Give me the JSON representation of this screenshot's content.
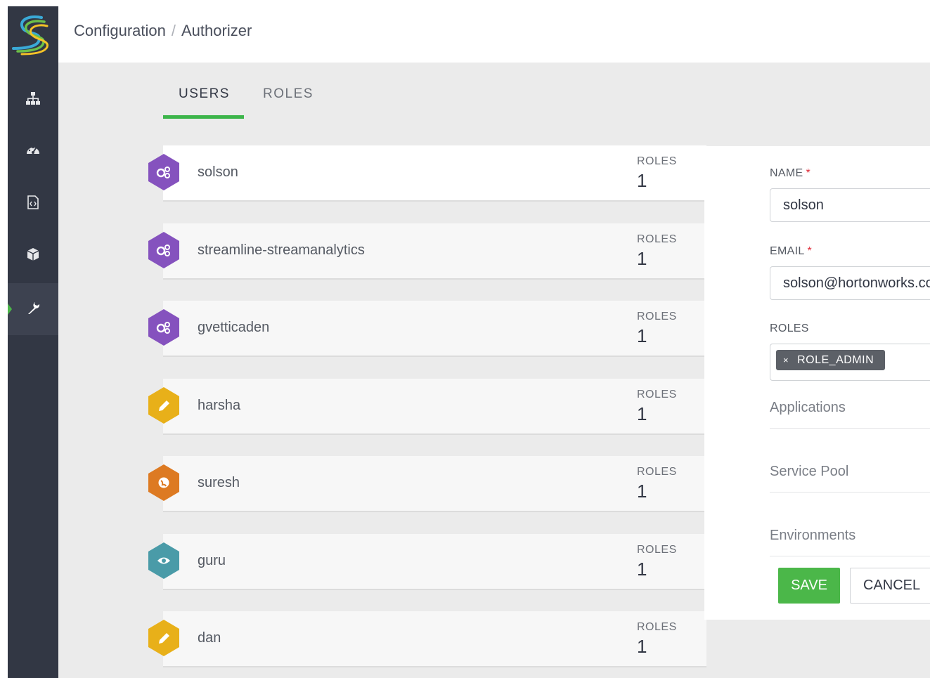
{
  "breadcrumb": {
    "parent": "Configuration",
    "separator": "/",
    "current": "Authorizer"
  },
  "sidebar": {
    "logo": "streamline-logo",
    "items": [
      {
        "name": "topology",
        "icon": "sitemap-icon",
        "active": false
      },
      {
        "name": "dashboard",
        "icon": "dashboard-icon",
        "active": false
      },
      {
        "name": "code",
        "icon": "file-code-icon",
        "active": false
      },
      {
        "name": "packages",
        "icon": "cube-icon",
        "active": false
      },
      {
        "name": "configuration",
        "icon": "wrench-icon",
        "active": true
      }
    ]
  },
  "tabs": [
    {
      "label": "USERS",
      "active": true
    },
    {
      "label": "ROLES",
      "active": false
    }
  ],
  "users": [
    {
      "name": "solson",
      "roles_label": "ROLES",
      "roles_count": "1",
      "icon": "cogs-icon",
      "color": "#8552be"
    },
    {
      "name": "streamline-streamanalytics",
      "roles_label": "ROLES",
      "roles_count": "1",
      "icon": "cogs-icon",
      "color": "#8552be"
    },
    {
      "name": "gvetticaden",
      "roles_label": "ROLES",
      "roles_count": "1",
      "icon": "cogs-icon",
      "color": "#8552be"
    },
    {
      "name": "harsha",
      "roles_label": "ROLES",
      "roles_count": "1",
      "icon": "pencil-icon",
      "color": "#e8b019"
    },
    {
      "name": "suresh",
      "roles_label": "ROLES",
      "roles_count": "1",
      "icon": "globe-icon",
      "color": "#dd7a22"
    },
    {
      "name": "guru",
      "roles_label": "ROLES",
      "roles_count": "1",
      "icon": "eye-icon",
      "color": "#4a9ba8"
    },
    {
      "name": "dan",
      "roles_label": "ROLES",
      "roles_count": "1",
      "icon": "pencil-icon",
      "color": "#e8b019"
    }
  ],
  "form": {
    "name_label": "NAME",
    "name_value": "solson",
    "email_label": "EMAIL",
    "email_value": "solson@hortonworks.com",
    "required_mark": "*",
    "roles_label": "ROLES",
    "roles_tags": [
      "ROLE_ADMIN"
    ],
    "tag_remove": "×",
    "sections": [
      "Applications",
      "Service Pool",
      "Environments"
    ],
    "save_label": "SAVE",
    "cancel_label": "CANCEL"
  },
  "colors": {
    "accent": "#4bb749",
    "sidebar": "#323744",
    "required": "#e0313e"
  }
}
